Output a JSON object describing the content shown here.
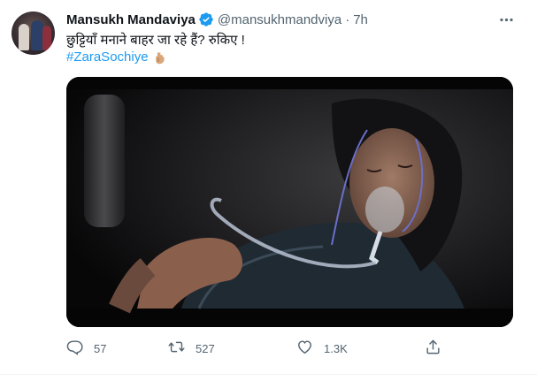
{
  "author": {
    "name": "Mansukh Mandaviya",
    "handle": "@mansukhmandviya",
    "separator": "·",
    "time": "7h",
    "verified": true
  },
  "tweet": {
    "text": "छुट्टियाँ मनाने बाहर जा रहे हैं? रुकिए !",
    "hashtag": "#ZaraSochiye",
    "emoji": "pointing-down-hand-emoji"
  },
  "media": {
    "type": "video-still",
    "description_colors": {
      "background": "#0a0a0a",
      "skin": "#8a6a5a",
      "tube": "#b9c2d4"
    }
  },
  "actions": {
    "reply": {
      "icon": "reply-icon",
      "count": "57"
    },
    "retweet": {
      "icon": "retweet-icon",
      "count": "527"
    },
    "like": {
      "icon": "heart-icon",
      "count": "1.3K"
    },
    "share": {
      "icon": "share-icon"
    }
  },
  "colors": {
    "accent": "#1d9bf0",
    "text": "#0f1419",
    "muted": "#536471"
  }
}
